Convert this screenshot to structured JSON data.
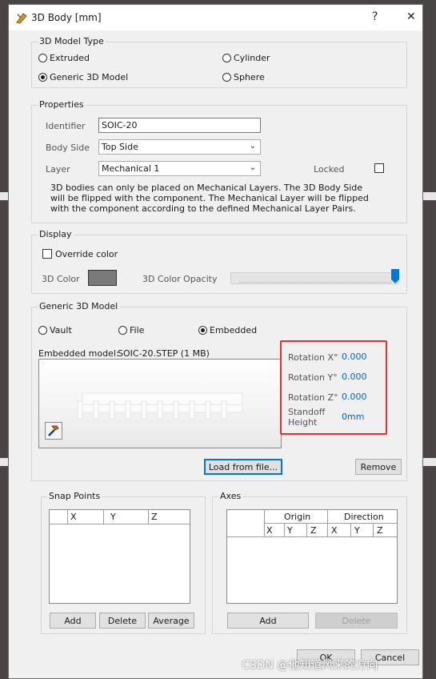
{
  "window": {
    "title": "3D Body [mm]",
    "help_label": "?",
    "close_label": "✕"
  },
  "model_type": {
    "label": "3D Model Type",
    "extruded": "Extruded",
    "cylinder": "Cylinder",
    "generic": "Generic 3D Model",
    "sphere": "Sphere",
    "selected": "Generic 3D Model"
  },
  "properties": {
    "label": "Properties",
    "identifier_label": "Identifier",
    "identifier_value": "SOIC-20",
    "body_side_label": "Body Side",
    "body_side_value": "Top Side",
    "layer_label": "Layer",
    "layer_value": "Mechanical 1",
    "locked_label": "Locked",
    "locked_checked": false,
    "note": "3D bodies can only be placed on Mechanical Layers. The 3D Body Side will be flipped with the component. The Mechanical Layer will be flipped with the component according to the defined Mechanical Layer Pairs."
  },
  "display": {
    "label": "Display",
    "override_label": "Override color",
    "override_checked": false,
    "color_label": "3D Color",
    "color_swatch": "#7a7a7a",
    "opacity_label": "3D Color Opacity",
    "opacity_value": 1.0
  },
  "generic_model": {
    "label": "Generic 3D Model",
    "vault": "Vault",
    "file": "File",
    "embedded": "Embedded",
    "selected": "Embedded",
    "embedded_model_label": "Embedded model:",
    "embedded_model_value": "SOIC-20.STEP (1 MB)",
    "rotation_x_label": "Rotation X°",
    "rotation_x_value": "0.000",
    "rotation_y_label": "Rotation Y°",
    "rotation_y_value": "0.000",
    "rotation_z_label": "Rotation Z°",
    "rotation_z_value": "0.000",
    "standoff_label_1": "Standoff",
    "standoff_label_2": "Height",
    "standoff_value": "0mm",
    "load_button": "Load from file...",
    "remove_button": "Remove",
    "highlight_color": "#e03030"
  },
  "snap_points": {
    "label": "Snap Points",
    "columns": [
      "X",
      "Y",
      "Z"
    ],
    "add_button": "Add",
    "delete_button": "Delete",
    "average_button": "Average"
  },
  "axes": {
    "label": "Axes",
    "group_origin": "Origin",
    "group_direction": "Direction",
    "columns": [
      "X",
      "Y",
      "Z",
      "X",
      "Y",
      "Z"
    ],
    "add_button": "Add",
    "delete_button": "Delete"
  },
  "footer": {
    "ok": "OK",
    "cancel": "Cancel"
  },
  "watermark": "CSDN @他知道风来的方向"
}
